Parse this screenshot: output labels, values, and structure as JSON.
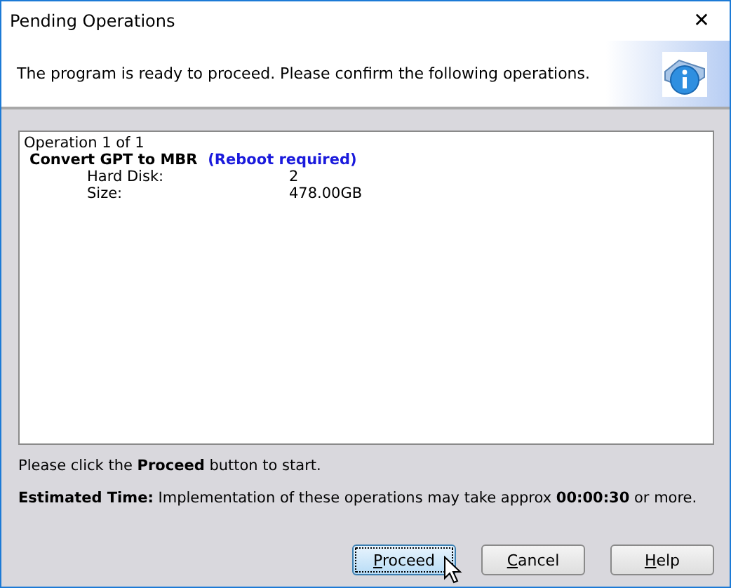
{
  "window": {
    "title": "Pending Operations",
    "close": "✕"
  },
  "header": {
    "message": "The program is ready to proceed. Please confirm the following operations."
  },
  "operations": {
    "counter": "Operation 1 of 1",
    "title": "Convert GPT to MBR",
    "note": "(Reboot required)",
    "details": [
      {
        "label": "Hard Disk:",
        "value": "2"
      },
      {
        "label": "Size:",
        "value": "478.00GB"
      }
    ]
  },
  "instruction": "Please click the **Proceed** button to start.",
  "estimate": "**Estimated Time:** Implementation of these operations may take approx **00:00:30** or more.",
  "buttons": [
    {
      "label": "Proceed",
      "focused": true,
      "underline_first": true
    },
    {
      "label": "Cancel",
      "focused": false,
      "underline_first": true
    },
    {
      "label": "Help",
      "focused": false,
      "underline_first": true
    }
  ]
}
